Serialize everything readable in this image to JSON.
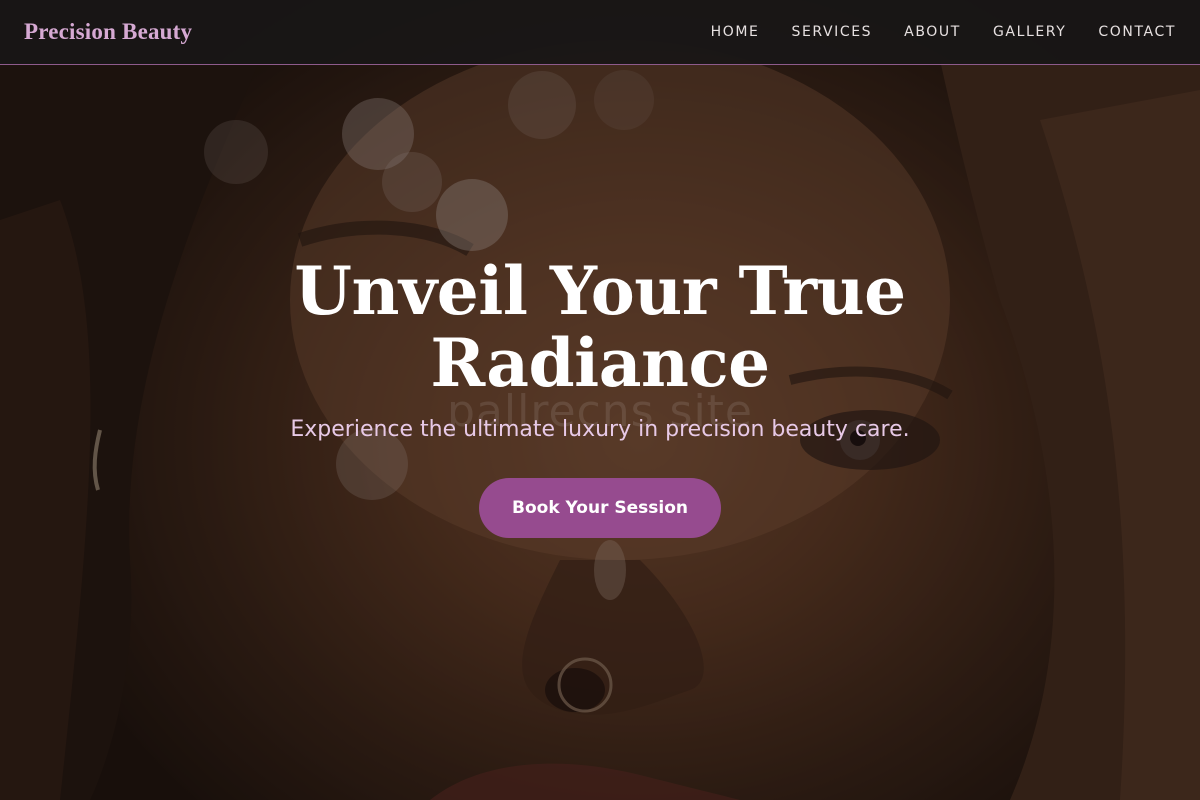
{
  "nav": {
    "brand": "Precision Beauty",
    "links": [
      {
        "label": "HOME"
      },
      {
        "label": "SERVICES"
      },
      {
        "label": "ABOUT"
      },
      {
        "label": "GALLERY"
      },
      {
        "label": "CONTACT"
      }
    ]
  },
  "hero": {
    "title": "Unveil Your True Radiance",
    "subtitle": "Experience the ultimate luxury in precision beauty care.",
    "cta_label": "Book Your Session",
    "watermark": "pallrecns site"
  },
  "colors": {
    "brand": "#d6a9d3",
    "accent": "#964b8f",
    "nav_border": "#8e5b8c",
    "subtitle": "#e7c9e6"
  }
}
